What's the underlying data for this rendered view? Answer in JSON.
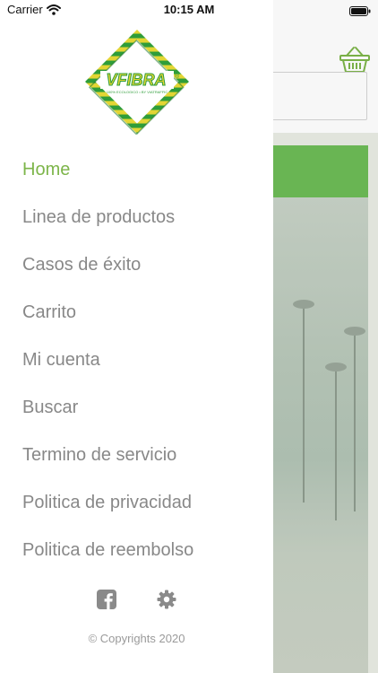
{
  "status_bar": {
    "carrier": "Carrier",
    "time": "10:15 AM"
  },
  "logo": {
    "brand": "VFIBRA",
    "tagline": "100% ECOLOGICO • BY VIATRAFFIC",
    "mark": "®"
  },
  "menu": {
    "active_index": 0,
    "items": [
      {
        "label": "Home"
      },
      {
        "label": "Linea de productos"
      },
      {
        "label": "Casos de éxito"
      },
      {
        "label": "Carrito"
      },
      {
        "label": "Mi cuenta"
      },
      {
        "label": "Buscar"
      },
      {
        "label": "Termino de servicio"
      },
      {
        "label": "Politica de privacidad"
      },
      {
        "label": "Politica de reembolso"
      }
    ]
  },
  "footer": {
    "copyright": "© Copyrights 2020",
    "icons": [
      "facebook-icon",
      "gear-icon"
    ]
  },
  "background_app": {
    "cart_icon": "shopping-basket-icon"
  },
  "colors": {
    "accent": "#7db54a",
    "menu_text": "#888888",
    "green_band": "#6dbb56",
    "logo_green": "#2f9d3a",
    "logo_yellow": "#e3d534"
  }
}
